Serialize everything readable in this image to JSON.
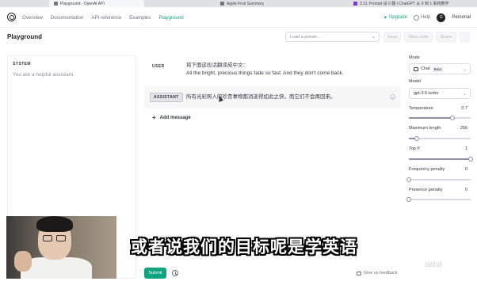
{
  "browser": {
    "tabs": [
      {
        "label": "Playground - OpenAI API"
      },
      {
        "label": "Apple Fruit Summary"
      },
      {
        "label": "3.11: Prompt 设 0 翻 | ChatGPT 从 0 到 1 系统教学"
      }
    ]
  },
  "nav": {
    "links": [
      "Overview",
      "Documentation",
      "API reference",
      "Examples",
      "Playground"
    ],
    "upgrade": "Upgrade",
    "help": "Help",
    "avatar_initial": "G",
    "account": "Personal"
  },
  "header": {
    "title": "Playground",
    "preset_placeholder": "Load a preset...",
    "save": "Save",
    "view_code": "View code",
    "share": "Share",
    "more": "···"
  },
  "system": {
    "label": "SYSTEM",
    "placeholder": "You are a helpful assistant."
  },
  "messages": [
    {
      "role": "USER",
      "lines": [
        "将下面这段话翻译成中文：",
        "All the bright, precious things fade so fast. And they don't come back."
      ]
    },
    {
      "role": "ASSISTANT",
      "lines": [
        "所有光彩照人的珍贵事物都消逝得如此之快，而它们不会再回来。"
      ]
    }
  ],
  "add_message": "Add message",
  "settings": {
    "mode_label": "Mode",
    "mode_value": "Chat",
    "mode_badge": "Beta",
    "model_label": "Model",
    "model_value": "gpt-3.5-turbo",
    "temperature_label": "Temperature",
    "temperature_value": "0.7",
    "temperature": 0.7,
    "max_length_label": "Maximum length",
    "max_length_value": "256",
    "max_length": 0.13,
    "top_p_label": "Top P",
    "top_p_value": "1",
    "top_p": 1.0,
    "freq_label": "Frequency penalty",
    "freq_value": "0",
    "freq": 0,
    "pres_label": "Presence penalty",
    "pres_value": "0",
    "pres": 0
  },
  "footer": {
    "submit": "Submit",
    "feedback": "Give us feedback"
  },
  "overlay": {
    "subtitle": "或者说我们的目标呢是学英语",
    "watermark": "bilibili"
  },
  "colors": {
    "accent": "#10a37f"
  }
}
